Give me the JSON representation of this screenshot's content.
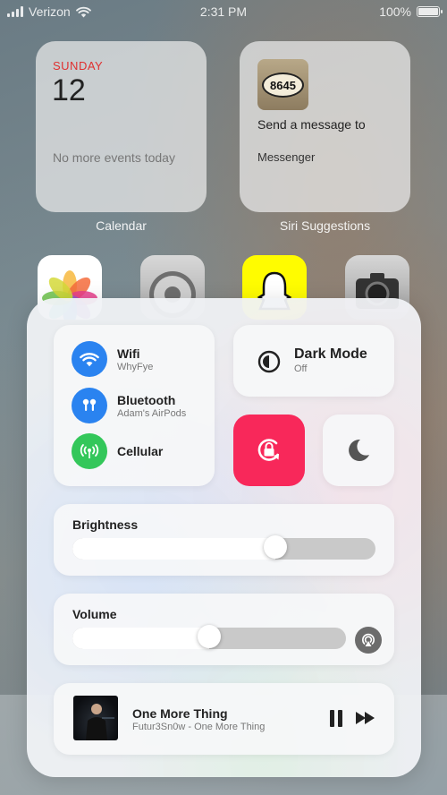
{
  "status_bar": {
    "carrier": "Verizon",
    "time": "2:31 PM",
    "battery": "100%"
  },
  "widgets": {
    "calendar": {
      "day_name": "SUNDAY",
      "date": "12",
      "events": "No more events today",
      "label": "Calendar"
    },
    "siri": {
      "thumb_text": "8645",
      "title": "Send a message to",
      "subtitle": "Messenger",
      "label": "Siri Suggestions"
    }
  },
  "control_center": {
    "connectivity": [
      {
        "name": "Wifi",
        "detail": "WhyFye",
        "icon": "wifi-icon",
        "color": "#2a83f0"
      },
      {
        "name": "Bluetooth",
        "detail": "Adam's AirPods",
        "icon": "airpods-icon",
        "color": "#2a83f0"
      },
      {
        "name": "Cellular",
        "detail": "",
        "icon": "cellular-icon",
        "color": "#33c75a"
      }
    ],
    "dark_mode": {
      "title": "Dark Mode",
      "status": "Off",
      "icon": "dark-mode-icon"
    },
    "rotation_lock": {
      "icon": "rotation-lock-icon",
      "color": "#f8285a"
    },
    "do_not_disturb": {
      "icon": "moon-icon"
    },
    "brightness": {
      "label": "Brightness",
      "level": 0.67
    },
    "volume": {
      "label": "Volume",
      "level": 0.5,
      "airplay_icon": "airplay-icon"
    },
    "now_playing": {
      "title": "One More Thing",
      "artist": "Futur3Sn0w - One More Thing",
      "play_icon": "pause-icon",
      "next_icon": "fast-forward-icon"
    }
  }
}
